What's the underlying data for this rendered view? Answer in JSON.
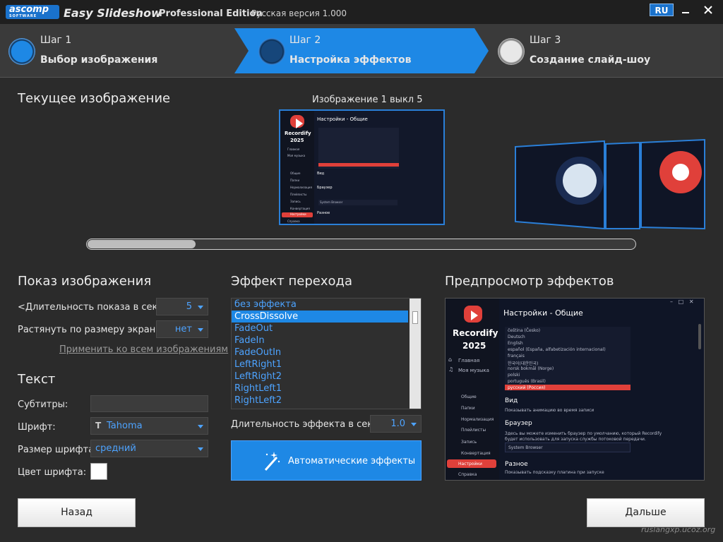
{
  "titlebar": {
    "logo_text": "ascomp",
    "logo_sub": "SOFTWARE",
    "app_name": "Easy Slideshow",
    "edition": "Professional Edition",
    "version": "Русская версия 1.000",
    "lang_button": "RU",
    "minimize_icon": "minimize-icon",
    "close_icon": "close-icon"
  },
  "steps": [
    {
      "step": "Шаг 1",
      "title": "Выбор изображения"
    },
    {
      "step": "Шаг 2",
      "title": "Настройка эффектов",
      "active": true
    },
    {
      "step": "Шаг 3",
      "title": "Создание слайд-шоу"
    }
  ],
  "current_image": {
    "title": "Текущее изображение",
    "counter": "Изображение 1 выкл 5",
    "thumbnail_texts": {
      "app": "Recordify",
      "year": "2025",
      "header": "Настройки - Общие",
      "nav_home": "Главная",
      "nav_music": "Моя музыка",
      "nav_general": "Общие",
      "nav_folders": "Папки",
      "nav_normalize": "Нормализация",
      "nav_playlists": "Плейлисты",
      "nav_record": "Запись",
      "nav_convert": "Конвертация",
      "nav_settings": "Настройки",
      "nav_help": "Справка",
      "sec_view": "Вид",
      "sec_browser": "Браузер",
      "browser_select": "System Browser",
      "sec_misc": "Разное"
    }
  },
  "show_image": {
    "title": "Показ изображения",
    "duration_label": "<Длительность показа в секунд",
    "duration_value": "5",
    "stretch_label": "Растянуть по размеру экрана:",
    "stretch_value": "нет",
    "apply_all": "Применить ко всем изображениям"
  },
  "text_section": {
    "title": "Текст",
    "subtitles_label": "Субтитры:",
    "subtitles_value": "",
    "font_label": "Шрифт:",
    "font_value": "Tahoma",
    "font_size_label": "Размер шрифта:",
    "font_size_value": "средний",
    "font_color_label": "Цвет шрифта:",
    "font_color": "#ffffff"
  },
  "transition": {
    "title": "Эффект перехода",
    "effects": [
      "без эффекта",
      "CrossDissolve",
      "FadeOut",
      "FadeIn",
      "FadeOutIn",
      "LeftRight1",
      "LeftRight2",
      "RightLeft1",
      "RightLeft2"
    ],
    "selected": "CrossDissolve",
    "duration_label": "Длительность эффекта в секунд",
    "duration_value": "1.0",
    "auto_button": "Автоматические эффекты"
  },
  "preview": {
    "title": "Предпросмотр эффектов",
    "app": "Recordify",
    "year": "2025",
    "header": "Настройки - Общие",
    "nav_home": "Главная",
    "nav_music": "Моя музыка",
    "nav_general": "Общие",
    "nav_folders": "Папки",
    "nav_normalize": "Нормализация",
    "nav_playlists": "Плейлисты",
    "nav_record": "Запись",
    "nav_convert": "Конвертация",
    "nav_settings": "Настройки",
    "nav_help": "Справка",
    "languages": [
      "čeština (Česko)",
      "Deutsch",
      "English",
      "español (España, alfabetización internacional)",
      "français",
      "한국어(대한민국)",
      "norsk bokmål (Norge)",
      "polski",
      "português (Brasil)",
      "русский (Россия)"
    ],
    "selected_language": "русский (Россия)",
    "sec_view": "Вид",
    "view_option": "Показывать анимацию во время записи",
    "sec_browser": "Браузер",
    "browser_desc1": "Здесь вы можете изменить браузер по умолчанию, который Recordify",
    "browser_desc2": "будет использовать для запуска службы потоковой передачи.",
    "browser_select": "System Browser",
    "sec_misc": "Разное",
    "misc_option": "Показывать подсказку плагина при запуске"
  },
  "nav": {
    "back": "Назад",
    "next": "Дальше"
  },
  "watermark": "ruslangxp.ucoz.org",
  "colors": {
    "accent": "#1e88e5",
    "link": "#4da3ff",
    "recordify_red": "#e0403a"
  }
}
